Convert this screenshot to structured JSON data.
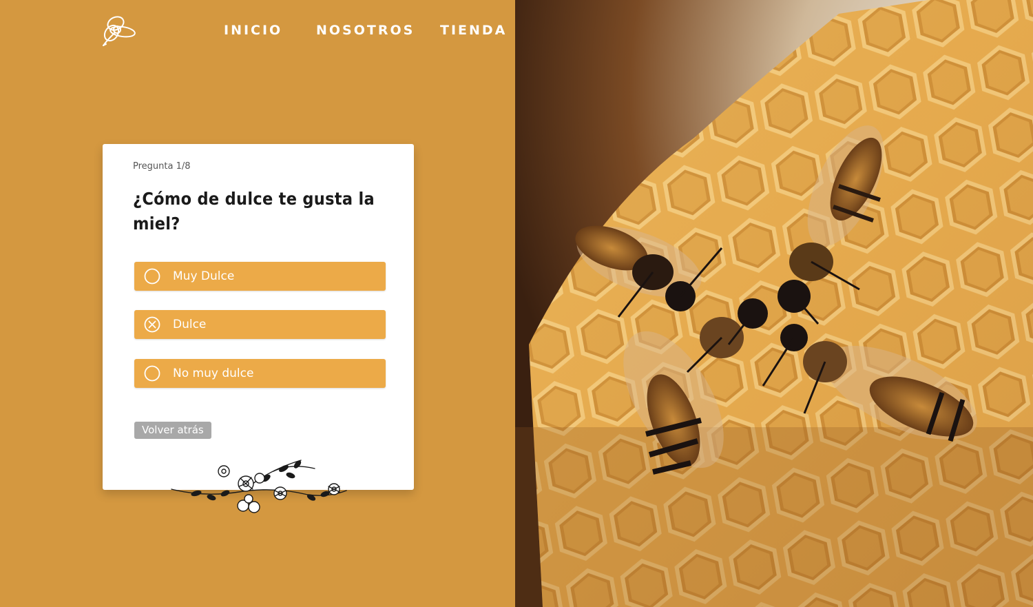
{
  "header": {
    "logo": "bee-flower-logo",
    "nav": [
      {
        "label": "INICIO"
      },
      {
        "label": "NOSOTROS"
      },
      {
        "label": "TIENDA"
      }
    ]
  },
  "quiz": {
    "counter": "Pregunta 1/8",
    "question": "¿Cómo de dulce te gusta la miel?",
    "options": [
      {
        "label": "Muy Dulce",
        "selected": false,
        "icon": "radio-empty-icon"
      },
      {
        "label": "Dulce",
        "selected": true,
        "icon": "radio-x-icon"
      },
      {
        "label": "No muy dulce",
        "selected": false,
        "icon": "radio-empty-icon"
      }
    ],
    "back_label": "Volver atrás"
  },
  "colors": {
    "panel": "#d49840",
    "option": "#ecaa48",
    "back_button": "#a8a8a8"
  },
  "photo": {
    "subject": "bees-on-honeycomb"
  }
}
